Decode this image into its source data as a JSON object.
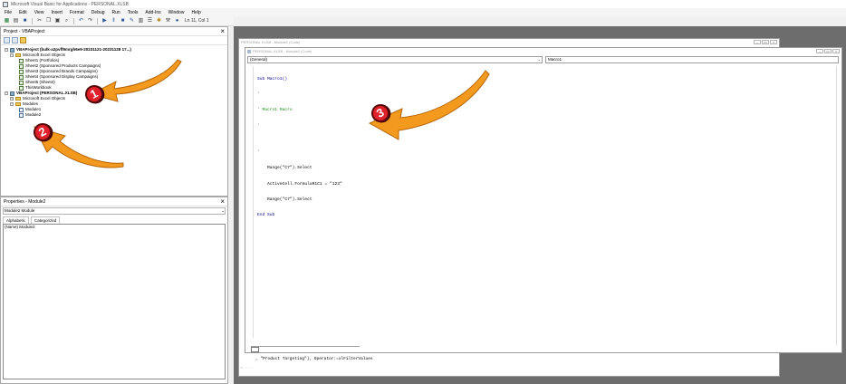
{
  "window": {
    "title": "Microsoft Visual Basic for Applications - PERSONAL.XLSB"
  },
  "menu": [
    "File",
    "Edit",
    "View",
    "Insert",
    "Format",
    "Debug",
    "Run",
    "Tools",
    "Add-Ins",
    "Window",
    "Help"
  ],
  "toolbar": {
    "position": "Ln 11, Col 1"
  },
  "project": {
    "title": "Project - VBAProject",
    "tree": [
      {
        "label": "VBAProject (bulk-a2pvff9mrgh6e9-20231121-20231128 17...)",
        "level": 0,
        "icon": "project-icon"
      },
      {
        "label": "Microsoft Excel Objects",
        "level": 1,
        "icon": "folder-icon"
      },
      {
        "label": "Sheet1 (Portfolios)",
        "level": 2,
        "icon": "sheet-icon"
      },
      {
        "label": "Sheet2 (Sponsored Products Campaigns)",
        "level": 2,
        "icon": "sheet-icon"
      },
      {
        "label": "Sheet3 (Sponsored Brands Campaigns)",
        "level": 2,
        "icon": "sheet-icon"
      },
      {
        "label": "Sheet4 (Sponsored Display Campaigns)",
        "level": 2,
        "icon": "sheet-icon"
      },
      {
        "label": "Sheet5 (Sheet4)",
        "level": 2,
        "icon": "sheet-icon"
      },
      {
        "label": "ThisWorkbook",
        "level": 2,
        "icon": "sheet-icon"
      },
      {
        "label": "VBAProject (PERSONAL.XLSB)",
        "level": 0,
        "icon": "project-icon"
      },
      {
        "label": "Microsoft Excel Objects",
        "level": 1,
        "icon": "folder-icon"
      },
      {
        "label": "Modules",
        "level": 1,
        "icon": "folder-icon"
      },
      {
        "label": "Module1",
        "level": 2,
        "icon": "module-icon"
      },
      {
        "label": "Module2",
        "level": 2,
        "icon": "module-icon"
      }
    ]
  },
  "properties": {
    "title": "Properties - Module2",
    "object": "Module2 Module",
    "tabs": [
      "Alphabetic",
      "Categorized"
    ],
    "rows": [
      {
        "name": "(Name)",
        "value": "Module2"
      }
    ]
  },
  "back_window": {
    "title": "PERSONAL.XLSB - Module1 (Code)",
    "code_line": ", \"Product Targeting\"), Operator:=xlFilterValues"
  },
  "front_window": {
    "title": "PERSONAL.XLSB - Module2 (Code)",
    "object_combo": "(General)",
    "proc_combo": "Macro1",
    "code": [
      {
        "text": "Sub Macro1()",
        "kind": "kw"
      },
      {
        "text": "'",
        "kind": "cm"
      },
      {
        "text": "' Macro1 Macro",
        "kind": "cm"
      },
      {
        "text": "'",
        "kind": "cm"
      },
      {
        "text": "",
        "kind": "plain"
      },
      {
        "text": "'",
        "kind": "cm"
      },
      {
        "text": "    Range(\"C7\").Select",
        "kind": "plain"
      },
      {
        "text": "    ActiveCell.FormulaR1C1 = \"123\"",
        "kind": "plain"
      },
      {
        "text": "    Range(\"C7\").Select",
        "kind": "plain"
      },
      {
        "text": "End Sub",
        "kind": "kw"
      }
    ]
  },
  "annotations": [
    {
      "number": "1",
      "color": "#e0202a"
    },
    {
      "number": "2",
      "color": "#e0202a"
    },
    {
      "number": "3",
      "color": "#e0202a"
    }
  ],
  "colors": {
    "arrow": "#f39a1e",
    "badge": "#e0202a",
    "workspace": "#6d6d6d"
  }
}
